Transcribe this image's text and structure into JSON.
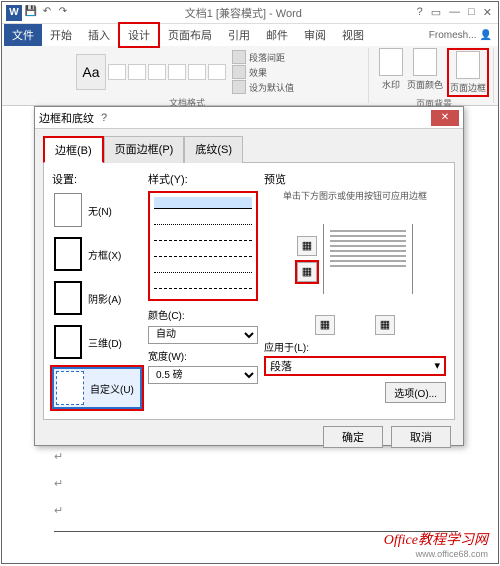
{
  "titlebar": {
    "doc_title": "文档1 [兼容模式] - Word"
  },
  "ribbon": {
    "tabs": [
      "文件",
      "开始",
      "插入",
      "设计",
      "页面布局",
      "引用",
      "邮件",
      "审阅",
      "视图"
    ],
    "user": "Fromesh...",
    "group1_label": "文档格式",
    "opts": {
      "a": "段落间距",
      "b": "效果",
      "c": "设为默认值"
    },
    "pagebg": {
      "label": "页面背景",
      "items": [
        "水印",
        "页面颜色",
        "页面边框"
      ]
    }
  },
  "dialog": {
    "title": "边框和底纹",
    "tabs": [
      "边框(B)",
      "页面边框(P)",
      "底纹(S)"
    ],
    "setting_label": "设置:",
    "settings": [
      "无(N)",
      "方框(X)",
      "阴影(A)",
      "三维(D)",
      "自定义(U)"
    ],
    "style_label": "样式(Y):",
    "color_label": "颜色(C):",
    "color_value": "自动",
    "width_label": "宽度(W):",
    "width_value": "0.5 磅",
    "preview_label": "预览",
    "preview_hint": "单击下方图示或使用按钮可应用边框",
    "apply_label": "应用于(L):",
    "apply_value": "段落",
    "options_btn": "选项(O)...",
    "ok": "确定",
    "cancel": "取消"
  },
  "footer": {
    "cn": "Office教程学习网",
    "en": "www.office68.com"
  }
}
